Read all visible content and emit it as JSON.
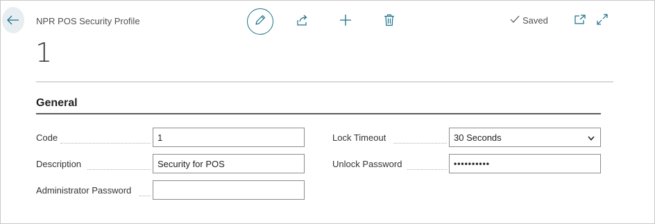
{
  "header": {
    "subtitle": "NPR POS Security Profile",
    "record_title": "1",
    "saved_label": "Saved"
  },
  "group": {
    "title": "General"
  },
  "fields": {
    "code": {
      "label": "Code",
      "value": "1"
    },
    "description": {
      "label": "Description",
      "value": "Security for POS"
    },
    "administrator_password": {
      "label": "Administrator Password",
      "value": ""
    },
    "lock_timeout": {
      "label": "Lock Timeout",
      "value": "30 Seconds"
    },
    "unlock_password": {
      "label": "Unlock Password",
      "value": "••••••••••"
    }
  },
  "icons": {
    "back": "arrow-left-icon",
    "edit": "pencil-icon",
    "share": "share-icon",
    "new": "plus-icon",
    "delete": "trash-icon",
    "saved": "checkmark-icon",
    "popout": "open-new-window-icon",
    "expand": "expand-icon",
    "dropdown": "chevron-down-icon"
  },
  "colors": {
    "accent": "#1a6f88",
    "back_button_bg": "#e6eef1"
  }
}
